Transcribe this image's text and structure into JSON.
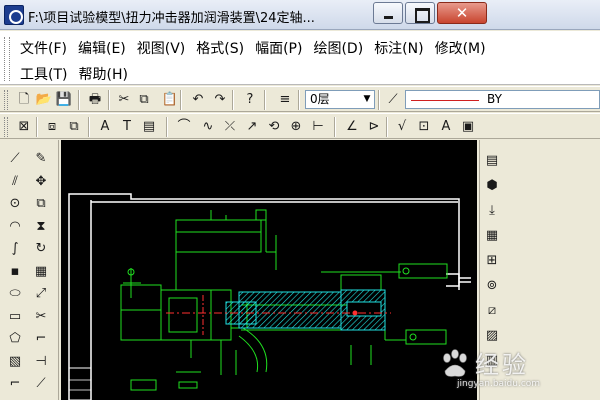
{
  "window": {
    "title": "F:\\项目试验模型\\扭力冲击器加润滑装置\\24定轴...",
    "buttons": {
      "minimize": "minimize",
      "maximize": "maximize",
      "close": "✕"
    }
  },
  "menu": {
    "row1": [
      "文件(F)",
      "编辑(E)",
      "视图(V)",
      "格式(S)",
      "幅面(P)",
      "绘图(D)",
      "标注(N)",
      "修改(M)"
    ],
    "row2": [
      "工具(T)",
      "帮助(H)"
    ]
  },
  "toolbar1": {
    "layer_value": "0层",
    "linetype_value": "BY",
    "icons": [
      "new-icon",
      "open-icon",
      "save-icon",
      "print-icon",
      "cut-icon",
      "copy-icon",
      "paste-icon",
      "undo-icon",
      "redo-icon",
      "help-icon",
      "layers-icon",
      "linetype-icon"
    ],
    "glyphs": [
      "🗋",
      "📂",
      "💾",
      "🖶",
      "✂",
      "⧉",
      "📋",
      "↶",
      "↷",
      "?",
      "≡",
      "⟋"
    ]
  },
  "toolbar2": {
    "icons": [
      "zoom-extent-icon",
      "zoom-window-icon",
      "zoom-prev-icon",
      "text-icon",
      "text-edit-icon",
      "table-icon",
      "arc-icon",
      "wave-line-icon",
      "break-icon",
      "leader-icon",
      "rotate-dim-icon",
      "center-mark-icon",
      "dimension-icon",
      "angle-dim-icon",
      "weld-icon",
      "roughness-icon",
      "tolerance-icon",
      "datum-icon",
      "image-icon"
    ],
    "glyphs": [
      "⊠",
      "⧈",
      "⧉",
      "A",
      "T",
      "▤",
      "⌒",
      "∿",
      "⤫",
      "↗",
      "⟲",
      "⊕",
      "⊢",
      "∠",
      "⊳",
      "√",
      "⊡",
      "A",
      "▣"
    ]
  },
  "left_palette": {
    "icons": [
      "line-icon",
      "pencil-icon",
      "double-line-icon",
      "move-icon",
      "circle-icon",
      "copy-tool-icon",
      "arc-tool-icon",
      "mirror-icon",
      "spline-icon",
      "rotate-icon",
      "rect-fill-icon",
      "array-icon",
      "ellipse-icon",
      "scale-icon",
      "rectangle-icon",
      "trim-icon",
      "polygon-icon",
      "fillet-icon",
      "hatch-icon",
      "extend-icon",
      "polyline-icon",
      "chamfer-icon"
    ],
    "glyphs": [
      "⟋",
      "✎",
      "⫽",
      "✥",
      "⊙",
      "⧉",
      "◠",
      "⧗",
      "∫",
      "↻",
      "▪",
      "▦",
      "⬭",
      "⤢",
      "▭",
      "✂",
      "⬠",
      "⌐",
      "▧",
      "⊣",
      "⌐",
      "⟋"
    ]
  },
  "right_palette": {
    "icons": [
      "block-icon",
      "cube-icon",
      "insert-icon",
      "parts-lib-icon",
      "view-icon",
      "section-icon",
      "detail-icon",
      "hatch-view-icon",
      "grid-icon"
    ],
    "glyphs": [
      "▤",
      "⬢",
      "⤓",
      "▦",
      "⊞",
      "⊚",
      "⧄",
      "▨",
      "▥"
    ]
  },
  "watermark": {
    "text": "经验",
    "sub": "jingyan.baidu.com"
  },
  "colors": {
    "drawing_green": "#20e020",
    "drawing_cyan": "#20e0e0",
    "drawing_red": "#ff3030",
    "frame_white": "#ffffff"
  }
}
